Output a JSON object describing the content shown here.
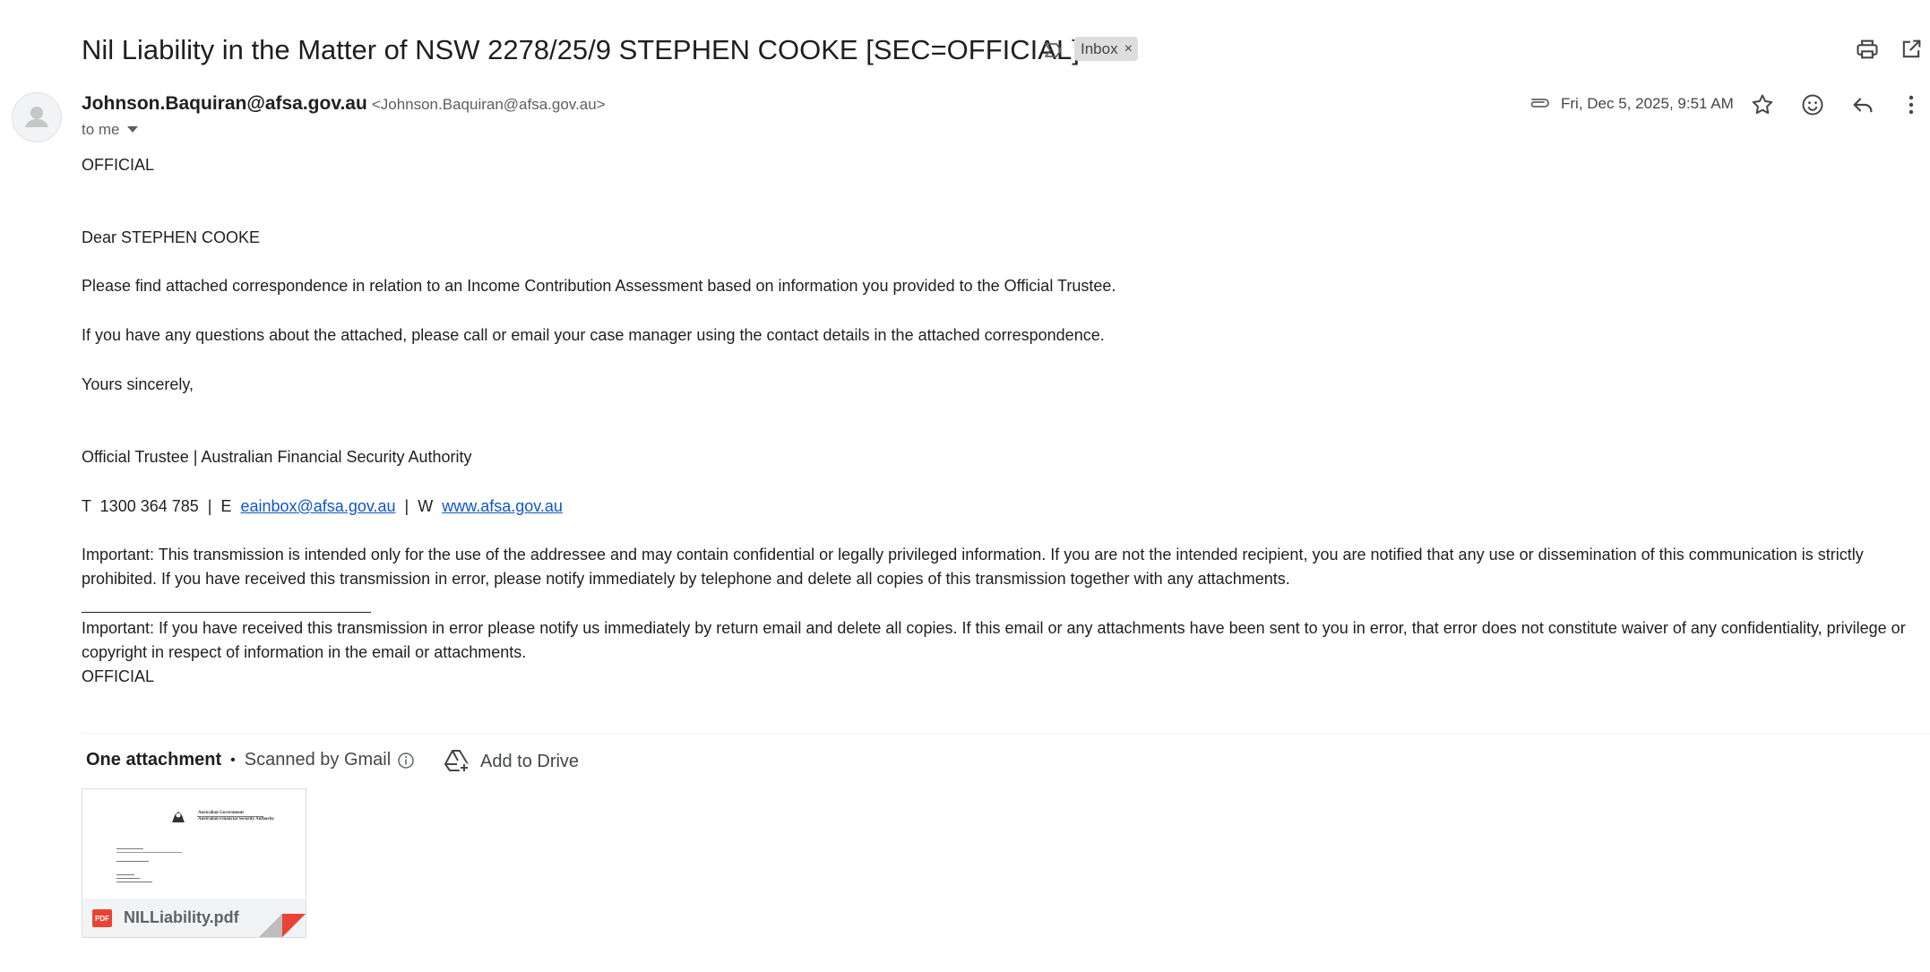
{
  "header": {
    "subject": "Nil Liability in the Matter of NSW 2278/25/9 STEPHEN COOKE [SEC=OFFICIAL]",
    "label": "Inbox",
    "label_remove": "×",
    "icons": [
      "importance-marker-icon",
      "print-icon",
      "open-in-new-window-icon"
    ]
  },
  "sender": {
    "name": "Johnson.Baquiran@afsa.gov.au",
    "email": "<Johnson.Baquiran@afsa.gov.au>",
    "to": "to me",
    "date": "Fri, Dec 5, 2025, 9:51 AM",
    "icons": [
      "avatar-icon",
      "attachment-clip-icon",
      "star-icon",
      "emoji-icon",
      "reply-icon",
      "more-vert-icon",
      "chevron-down-icon"
    ]
  },
  "body": {
    "classification_top": "OFFICIAL",
    "greeting": "Dear STEPHEN COOKE",
    "para1": "Please find attached correspondence in relation to an Income Contribution Assessment based on information you provided to the Official Trustee.",
    "para2": "If you have any questions about the attached, please call or email your case manager using the contact details in the attached correspondence.",
    "closing": "Yours sincerely,",
    "signature": "Official Trustee | Australian Financial Security Authority",
    "contact_t": "T  1300 364 785  |  E  ",
    "contact_email": "eainbox@afsa.gov.au",
    "contact_w": "  |  W  ",
    "contact_web": "www.afsa.gov.au",
    "notice1": "Important: This transmission is intended only for the use of the addressee and may contain confidential or legally privileged information. If you are not the intended recipient, you are notified that any use or dissemination of this communication is strictly prohibited. If you have received this transmission in error, please notify immediately by telephone and delete all copies of this transmission together with any attachments.",
    "notice2": "Important: If you have received this transmission in error please notify us immediately by return email and delete all copies. If this email or any attachments have been sent to you in error, that error does not constitute waiver of any confidentiality, privilege or copyright in respect of information in the email or attachments.",
    "classification_bottom": "OFFICIAL"
  },
  "attachments": {
    "count_label": "One attachment",
    "separator": "•",
    "scanned": "Scanned by Gmail",
    "add_to_drive": "Add to Drive",
    "file": {
      "name": "NILLiability.pdf",
      "type_badge": "PDF",
      "thumb_title1": "Australian Government",
      "thumb_title2": "Australian Financial Security Authority"
    },
    "icons": [
      "info-icon",
      "add-to-drive-icon",
      "pdf-icon"
    ]
  },
  "colors": {
    "text": "#1f1f1f",
    "secondary": "#444746",
    "link": "#1155cc",
    "chip_bg": "#dddddd",
    "pdf_red": "#ea4335"
  }
}
